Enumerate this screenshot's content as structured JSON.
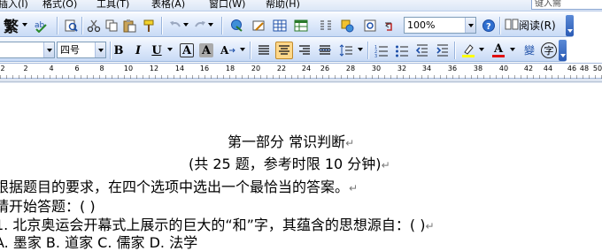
{
  "menubar": {
    "items": [
      {
        "id": "insert",
        "label": "插入(I)"
      },
      {
        "id": "format",
        "label": "格式(O)"
      },
      {
        "id": "tools",
        "label": "工具(T)"
      },
      {
        "id": "table",
        "label": "表格(A)"
      },
      {
        "id": "window",
        "label": "窗口(W)"
      },
      {
        "id": "help",
        "label": "帮助(H)"
      }
    ],
    "help_box": "键入需"
  },
  "toolbar1": {
    "trad_simp_label": "繁",
    "zoom_value": "100%",
    "read_label": "阅读(R)"
  },
  "toolbar2": {
    "font_size_value": "四号",
    "bold_label": "B",
    "italic_label": "I",
    "underline_label": "U",
    "char_border_label": "A",
    "char_shade_label": "A",
    "font_color_label": "A",
    "phonetic_label": "變",
    "enclose_label": "字"
  },
  "ruler": {
    "ticks": [
      "2",
      "2",
      "4",
      "6",
      "8",
      "10",
      "12",
      "14",
      "16",
      "18",
      "20",
      "22",
      "24",
      "26",
      "28",
      "30",
      "32",
      "34",
      "36",
      "38",
      "40",
      "42",
      "44",
      "46",
      "48",
      "50"
    ]
  },
  "document": {
    "lines": [
      "第一部分 常识判断",
      "(共 25 题，参考时限 10 分钟)",
      "根据题目的要求，在四个选项中选出一个最恰当的答案。",
      "请开始答题：(     )",
      "1. 北京奥运会开幕式上展示的巨大的“和”字，其蕴含的思想源自：(     )",
      "A. 墨家       B. 道家       C. 儒家       D. 法学"
    ],
    "paragraph_mark": "↵"
  },
  "colors": {
    "toolbar_top": "#f4f8fe",
    "toolbar_bottom": "#c8daf5",
    "highlight_yellow": "#ffd88a",
    "font_color_red": "#e01010",
    "highlight_pen_yellow": "#ffff00"
  }
}
